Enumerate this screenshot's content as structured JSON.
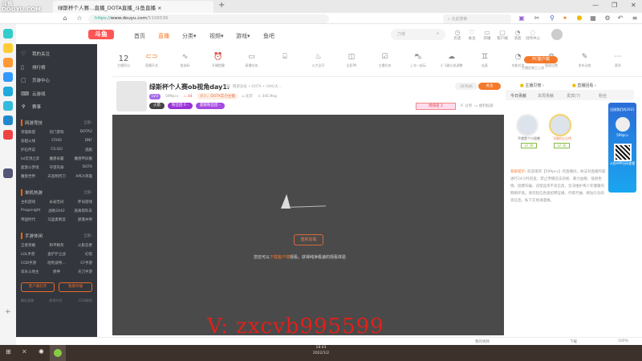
{
  "browser": {
    "tab_title": "绿斯杯个人赛…直播_DOTA直播_斗鱼直播",
    "url_scheme": "https://",
    "url_host": "www.douyu.com",
    "url_path": "/5106536",
    "search_placeholder": "点此搜索",
    "zoom": "100%",
    "status_left": "我的视频",
    "download": "下载"
  },
  "watermark_logo": "DOUYU.COM",
  "header": {
    "logo": "斗鱼",
    "nav": [
      "首页",
      "直播",
      "分类▾",
      "视频▾",
      "游戏▾",
      "鱼吧"
    ],
    "search_placeholder": "刀塔",
    "icons": [
      "历史",
      "关注",
      "开播",
      "客户端",
      "消息",
      "创作中心"
    ]
  },
  "sidebar": {
    "items": [
      "我的关注",
      "排行榜",
      "页游中心",
      "云游戏",
      "赛事"
    ],
    "sections": [
      {
        "title": "网游竞技",
        "more": "全部›",
        "games": [
          "英雄联盟",
          "热门游戏",
          "DOTA2",
          "穿越火线",
          "CFHD",
          "DNF",
          "炉石传说",
          "CS:GO",
          "逃跑",
          "lol云顶之弈",
          "魔兽争霸",
          "魔兽怀旧服",
          "超激斗梦境",
          "守望先锋",
          "DOTA",
          "魔兽世界",
          "天涯明月刀",
          "APEX英雄"
        ]
      },
      {
        "title": "单机热游",
        "more": "全部›",
        "games": [
          "主机游戏",
          "永劫无间",
          "怀旧游戏",
          "Progonight",
          "战地2042",
          "逃离塔科夫",
          "帝国时代",
          "马里奥制造",
          "部落冲突"
        ]
      },
      {
        "title": "手游休闲",
        "more": "全部›",
        "games": [
          "王者荣耀",
          "和平精英",
          "火影忍者",
          "LOL手游",
          "金铲铲之战",
          "幻塔",
          "COD手游",
          "哈利波特…",
          "CF手游",
          "双乐斗地主",
          "原神",
          "天刀手游"
        ]
      }
    ],
    "buttons": [
      "客户端打开",
      "我要开播"
    ],
    "footer": [
      "精彩直播",
      "影视节目",
      "1218赛程"
    ]
  },
  "toolbar": {
    "score": "12",
    "score_label": "主播积分",
    "items": [
      "直播开关",
      "推流码",
      "开播提醒",
      "直播任务",
      "",
      "火力全开",
      "全民PK",
      "主播任务",
      "上车一起玩",
      "小飞碟分成调整",
      "连麦",
      "充能任务",
      "管理设置",
      "发布动态",
      "更多"
    ],
    "pc_button": "PC客户端",
    "pc_sub": "主播定制已上线"
  },
  "stream": {
    "title": "绿斯杯个人赛ob视角day1.",
    "report": "举报",
    "category": "网游竞技 • DOTA • OMG大…",
    "level": "LV3",
    "streamer": "599pcv",
    "heat": "44",
    "tag": "冷少、DOTA实力主播",
    "location": "北京",
    "fans": "345.9kg",
    "views": "107646",
    "follow": "关注",
    "badges": [
      "火箭",
      "粉丝团 0 ›",
      "超级粉丝团 ›"
    ],
    "rank": "周排名 2",
    "share": "分享",
    "cast": "福利投屏"
  },
  "video": {
    "reload": "重新加载",
    "tip_pre": "您还可以",
    "tip_link": "下载客户端",
    "tip_post": "观看，获得纯净极速的观看体验"
  },
  "overlay_watermark": "V: zxcvb995599",
  "right": {
    "head": [
      "主播贝榜 ›",
      "直播回看 ›"
    ],
    "tabs": [
      "今日贡献",
      "本周贡献",
      "贵宾(7)",
      "粉丝"
    ],
    "fans": [
      {
        "name": "不就是个小怪兽",
        "lv": "LV 39"
      },
      {
        "name": "飞翔的丘比特",
        "lv": "LV 30"
      }
    ],
    "promo_title": "回顾我们的2021",
    "promo_name": "599pcv",
    "promo_qr": "斗鱼APP扫码查看",
    "notice_label": "系统提示:",
    "notice": "欢迎来到【599pcv】的直播间，依法对直播内容进行24小时巡查，禁止传播违法违规、暴力血腥、低俗色情、招嫖诈骗、违禁品等不良信息，坚决维护青少年健康的网络环境。请勿轻信各类招聘征婚、代练代抽、刷钻礼包码等信息，私下交易请谨慎。"
  },
  "taskbar": {
    "time": "18:43",
    "date": "2022/1/2"
  }
}
